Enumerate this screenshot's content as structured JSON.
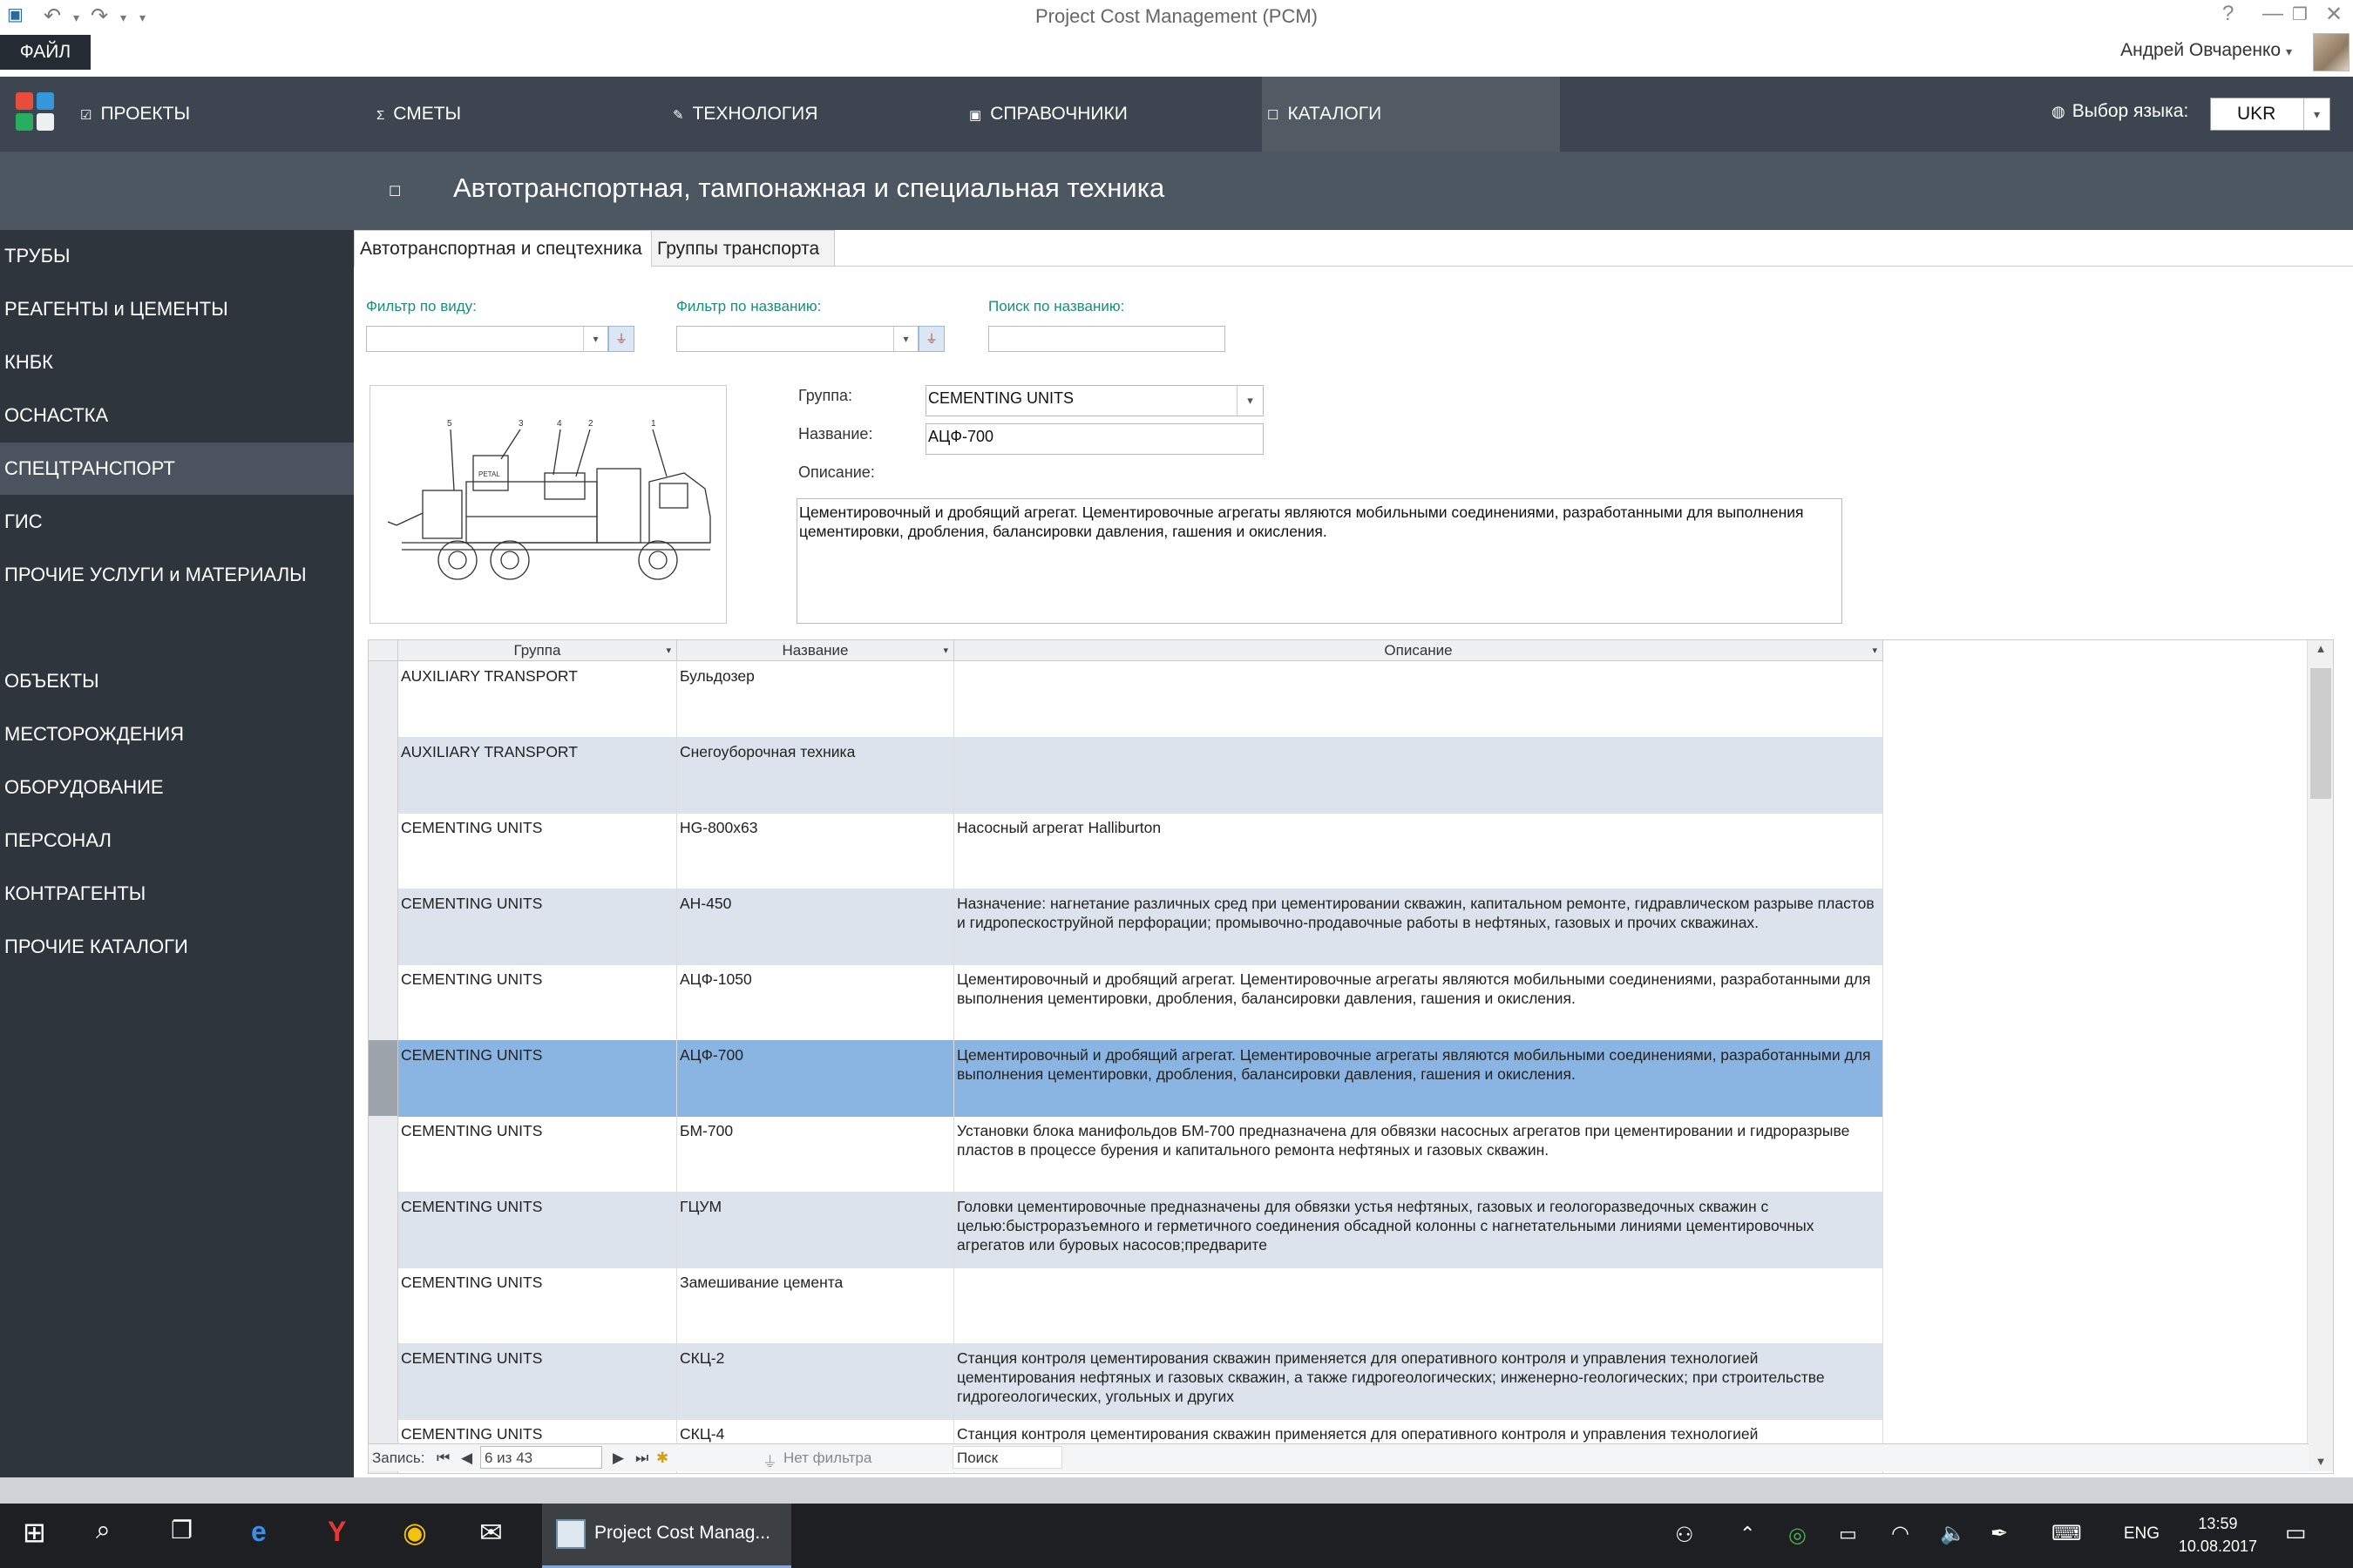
{
  "window": {
    "title": "Project Cost Management (PCM)",
    "help": "?",
    "minimize": "—",
    "restore": "❐",
    "close": "✕"
  },
  "ribbon": {
    "file_label": "ФАЙЛ",
    "user_name": "Андрей Овчаренко",
    "user_caret": "▾"
  },
  "topnav": {
    "items": [
      {
        "icon": "☑",
        "label": "ПРОЕКТЫ"
      },
      {
        "icon": "Σ",
        "label": "СМЕТЫ"
      },
      {
        "icon": "✎",
        "label": "ТЕХНОЛОГИЯ"
      },
      {
        "icon": "▣",
        "label": "СПРАВОЧНИКИ"
      },
      {
        "icon": "☐",
        "label": "КАТАЛОГИ"
      }
    ],
    "active": "КАТАЛОГИ",
    "language_label": "Выбор языка:",
    "language_value": "UKR"
  },
  "page": {
    "title": "Автотранспортная, тампонажная и специальная техника"
  },
  "sidebar": {
    "items_top": [
      {
        "label": "ТРУБЫ"
      },
      {
        "label": "РЕАГЕНТЫ и ЦЕМЕНТЫ"
      },
      {
        "label": "КНБК"
      },
      {
        "label": "ОСНАСТКА"
      },
      {
        "label": "СПЕЦТРАНСПОРТ"
      },
      {
        "label": "ГИС"
      },
      {
        "label": "ПРОЧИЕ УСЛУГИ и МАТЕРИАЛЫ"
      }
    ],
    "items_bottom": [
      {
        "label": "ОБЪЕКТЫ"
      },
      {
        "label": "МЕСТОРОЖДЕНИЯ"
      },
      {
        "label": "ОБОРУДОВАНИЕ"
      },
      {
        "label": "ПЕРСОНАЛ"
      },
      {
        "label": "КОНТРАГЕНТЫ"
      },
      {
        "label": "ПРОЧИЕ КАТАЛОГИ"
      }
    ],
    "active": "СПЕЦТРАНСПОРТ"
  },
  "tabs": [
    {
      "label": "Автотранспортная и спецтехника"
    },
    {
      "label": "Группы транспорта"
    }
  ],
  "filters": {
    "by_type_label": "Фильтр по виду:",
    "by_name_label": "Фильтр по названию:",
    "search_label": "Поиск по названию:"
  },
  "photo": {
    "callouts": [
      "5",
      "3",
      "4",
      "2",
      "1"
    ],
    "brand": "PETAL"
  },
  "form": {
    "group_label": "Группа:",
    "group_value": "CEMENTING UNITS",
    "name_label": "Название:",
    "name_value": "АЦФ-700",
    "description_label": "Описание:",
    "description_value": "Цементировочный и дробящий агрегат. Цементировочные агрегаты являются мобильными соединениями, разработанными для выполнения цементировки, дробления, балансировки давления, гашения и окисления."
  },
  "grid": {
    "columns": [
      "Группа",
      "Название",
      "Описание"
    ],
    "rows": [
      {
        "group": "AUXILIARY TRANSPORT",
        "name": "Бульдозер",
        "desc": ""
      },
      {
        "group": "AUXILIARY TRANSPORT",
        "name": "Снегоуборочная техника",
        "desc": ""
      },
      {
        "group": "CEMENTING UNITS",
        "name": "HG-800x63",
        "desc": "Насосный агрегат Halliburton"
      },
      {
        "group": "CEMENTING UNITS",
        "name": "АН-450",
        "desc": "Назначение: нагнетание различных сред при цементировании скважин, капитальном ремонте, гидравлическом разрыве пластов и гидропескоструйной перфорации; промывочно-продавочные работы в нефтяных, газовых и прочих скважинах."
      },
      {
        "group": "CEMENTING UNITS",
        "name": "АЦФ-1050",
        "desc": "Цементировочный и дробящий агрегат. Цементировочные агрегаты являются мобильными соединениями, разработанными для выполнения цементировки, дробления, балансировки давления, гашения и окисления."
      },
      {
        "group": "CEMENTING UNITS",
        "name": "АЦФ-700",
        "desc": "Цементировочный и дробящий агрегат. Цементировочные агрегаты являются мобильными соединениями, разработанными для выполнения цементировки, дробления, балансировки давления, гашения и окисления."
      },
      {
        "group": "CEMENTING UNITS",
        "name": "БМ-700",
        "desc": "Установки блока манифольдов БМ-700 предназначена для обвязки насосных агрегатов при цементировании и гидроразрыве пластов в процессе бурения и капитального ремонта нефтяных и газовых скважин."
      },
      {
        "group": "CEMENTING UNITS",
        "name": "ГЦУМ",
        "desc": "Головки цементировочные предназначены для обвязки устья нефтяных, газовых и геологоразведочных скважин с целью:быстроразъемного и герметичного соединения обсадной колонны с нагнетательными линиями цементировочных агрегатов или буровых насосов;предварите"
      },
      {
        "group": "CEMENTING UNITS",
        "name": "Замешивание цемента",
        "desc": ""
      },
      {
        "group": "CEMENTING UNITS",
        "name": "СКЦ-2",
        "desc": "Станция контроля цементирования скважин применяется для оперативного контроля и управления технологией цементирования нефтяных и газовых скважин, а также гидрогеологических; инженерно-геологических; при строительстве гидрогеологических, угольных и других"
      },
      {
        "group": "CEMENTING UNITS",
        "name": "СКЦ-4",
        "desc": "Станция контроля цементирования скважин применяется для оперативного контроля и управления технологией"
      }
    ],
    "selected_index": 5,
    "navigator": {
      "record_label": "Запись:",
      "position": "6 из 43",
      "filter_state": "Нет фильтра",
      "search_placeholder": "Поиск"
    }
  },
  "taskbar": {
    "app_label": "Project Cost Manag...",
    "language": "ENG",
    "time": "13:59",
    "date": "10.08.2017"
  }
}
